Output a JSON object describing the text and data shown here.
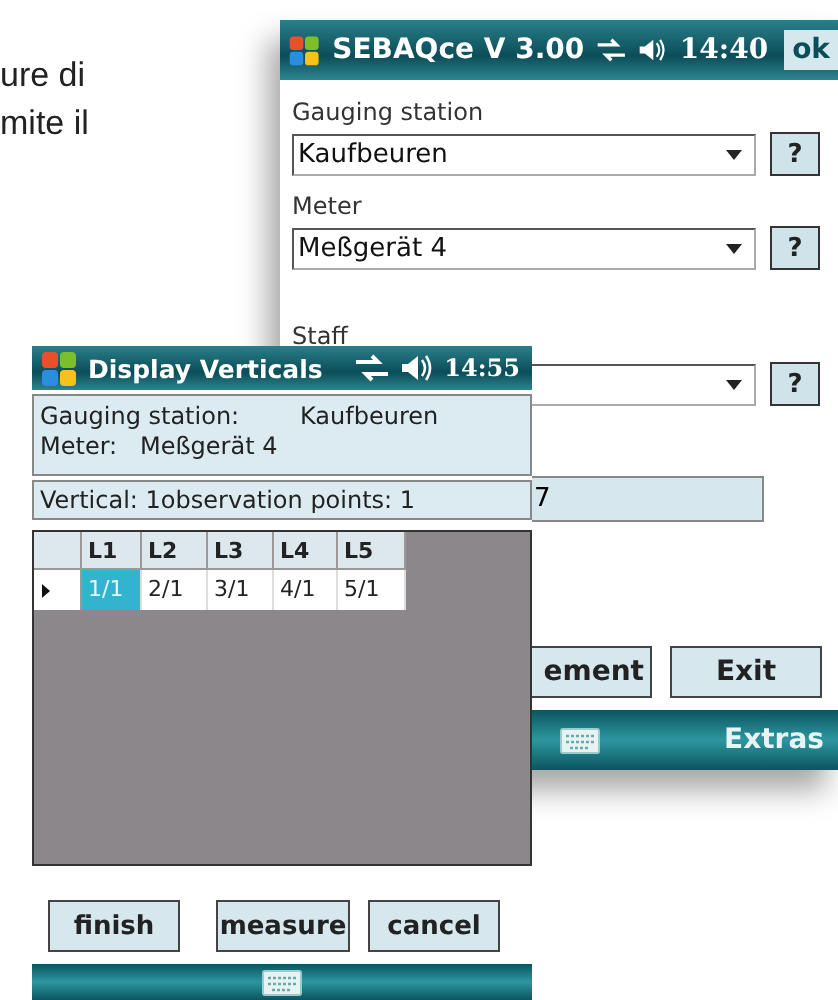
{
  "document_text": [
    "ure di",
    "mite il"
  ],
  "main_window": {
    "title": "SEBAQce V 3.00",
    "time": "14:40",
    "ok_button": "ok",
    "fields": [
      {
        "label": "Gauging station",
        "value": "Kaufbeuren",
        "help": "?"
      },
      {
        "label": "Meter",
        "value": "Meßgerät 4",
        "help": "?"
      },
      {
        "label": "Staff",
        "help": "?"
      }
    ],
    "text_field": {
      "value": "7"
    },
    "buttons": [
      "ement",
      "Exit"
    ],
    "menu_bar": {
      "right": "Extras"
    }
  },
  "dialog": {
    "title": "Display Verticals",
    "time": "14:55",
    "info": [
      {
        "label": "Gauging station:",
        "value": "Kaufbeuren"
      },
      {
        "label": "Meter:",
        "value": "Meßgerät 4"
      }
    ],
    "vertical_line": "Vertical: 1observation points: 1",
    "grid": {
      "columns": [
        "L1",
        "L2",
        "L3",
        "L4",
        "L5"
      ],
      "rows": [
        {
          "cells": [
            {
              "text": "1/1",
              "selected": true
            },
            {
              "text": "2/1",
              "selected": false
            },
            {
              "text": "3/1",
              "selected": false
            },
            {
              "text": "4/1",
              "selected": false
            },
            {
              "text": "5/1",
              "selected": false
            }
          ]
        }
      ]
    },
    "buttons": [
      "finish",
      "measure",
      "cancel"
    ]
  }
}
